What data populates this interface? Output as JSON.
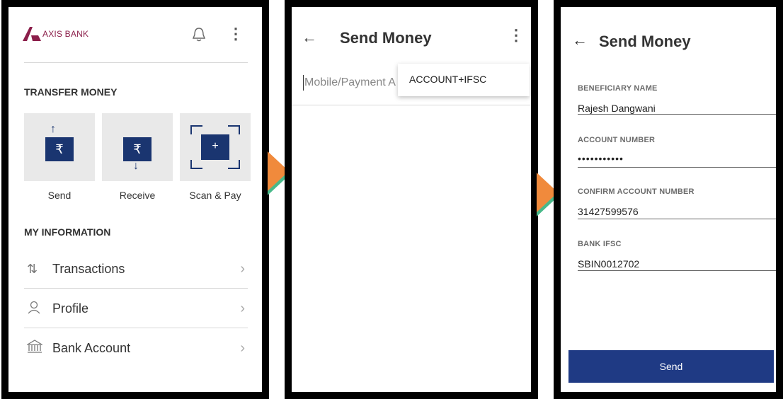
{
  "screen1": {
    "brand": "AXIS BANK",
    "brand_color": "#8b1e4a",
    "icons": [
      "bell-icon",
      "more-vertical-icon"
    ],
    "transfer_title": "TRANSFER MONEY",
    "tiles": [
      {
        "label": "Send",
        "icon": "send-rupee-icon",
        "glyph": "₹"
      },
      {
        "label": "Receive",
        "icon": "receive-rupee-icon",
        "glyph": "₹"
      },
      {
        "label": "Scan & Pay",
        "icon": "scan-icon",
        "glyph": "+"
      }
    ],
    "info_title": "MY INFORMATION",
    "rows": [
      {
        "label": "Transactions",
        "icon": "transactions-icon",
        "glyph": "⇅"
      },
      {
        "label": "Profile",
        "icon": "profile-icon",
        "glyph": "⚇"
      },
      {
        "label": "Bank Account",
        "icon": "bank-icon",
        "glyph": "🏛"
      }
    ],
    "chevron": "›"
  },
  "screen2": {
    "back": "←",
    "title": "Send Money",
    "more": "⋮",
    "input_placeholder": "Mobile/Payment A",
    "menu_item": "ACCOUNT+IFSC"
  },
  "screen3": {
    "back": "←",
    "title": "Send Money",
    "fields": [
      {
        "label": "BENEFICIARY NAME",
        "value": "Rajesh Dangwani"
      },
      {
        "label": "ACCOUNT NUMBER",
        "value": "•••••••••••"
      },
      {
        "label": "CONFIRM ACCOUNT NUMBER",
        "value": "31427599576"
      },
      {
        "label": "BANK IFSC",
        "value": "SBIN0012702"
      }
    ],
    "send_label": "Send",
    "button_color": "#1f3a84"
  },
  "accent_colors": {
    "arrow": "#f08a3c",
    "arrow_shadow": "#48b98a",
    "navy": "#1a3570"
  }
}
